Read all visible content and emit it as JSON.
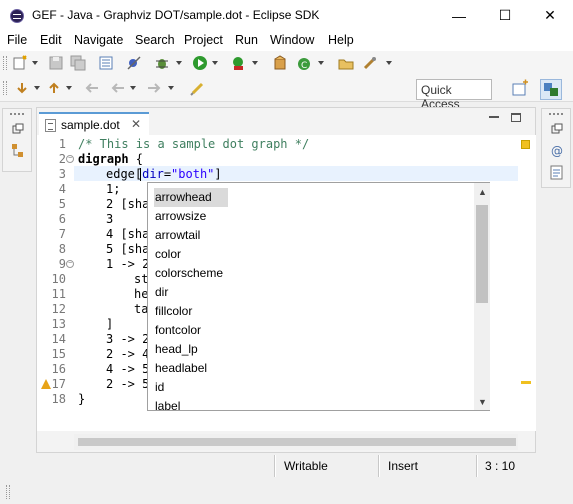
{
  "window": {
    "title": "GEF - Java - Graphviz DOT/sample.dot - Eclipse SDK",
    "min": "—",
    "max": "☐",
    "close": "✕"
  },
  "menu": [
    "File",
    "Edit",
    "Navigate",
    "Search",
    "Project",
    "Run",
    "Window",
    "Help"
  ],
  "toolbar": {
    "quick_access": "Quick Access"
  },
  "editor": {
    "tab_label": "sample.dot",
    "tab_close": "✕",
    "line_numbers": [
      "1",
      "2",
      "3",
      "4",
      "5",
      "6",
      "7",
      "8",
      "9",
      "10",
      "11",
      "12",
      "13",
      "14",
      "15",
      "16",
      "17",
      "18"
    ],
    "line_text": {
      "l4": "1;",
      "l5": "2 [sha",
      "l6": "3",
      "l7": "4 [sha",
      "l8": "5 [sha",
      "l9": "1 -> 2",
      "l10": "st",
      "l11": "he",
      "l12": "ta",
      "l13": "]",
      "l14": "3 -> 2",
      "l15": "2 -> 4",
      "l16": "4 -> 5",
      "l17": "2 -> 5",
      "l18": "}"
    },
    "line1": "/* This is a sample dot graph */",
    "line2_kw": "digraph",
    "line2_rest": " {",
    "line3_pre": "edge[",
    "line3_attr": "dir",
    "line3_eq": "=",
    "line3_str": "\"both\"",
    "line3_post": "]"
  },
  "autocomplete": {
    "items": [
      "arrowhead",
      "arrowsize",
      "arrowtail",
      "color",
      "colorscheme",
      "dir",
      "fillcolor",
      "fontcolor",
      "head_lp",
      "headlabel",
      "id",
      "label"
    ],
    "selected_index": 0,
    "scroll_up": "▲",
    "scroll_down": "▼"
  },
  "status": {
    "writable": "Writable",
    "insert": "Insert",
    "position": "3 : 10"
  }
}
